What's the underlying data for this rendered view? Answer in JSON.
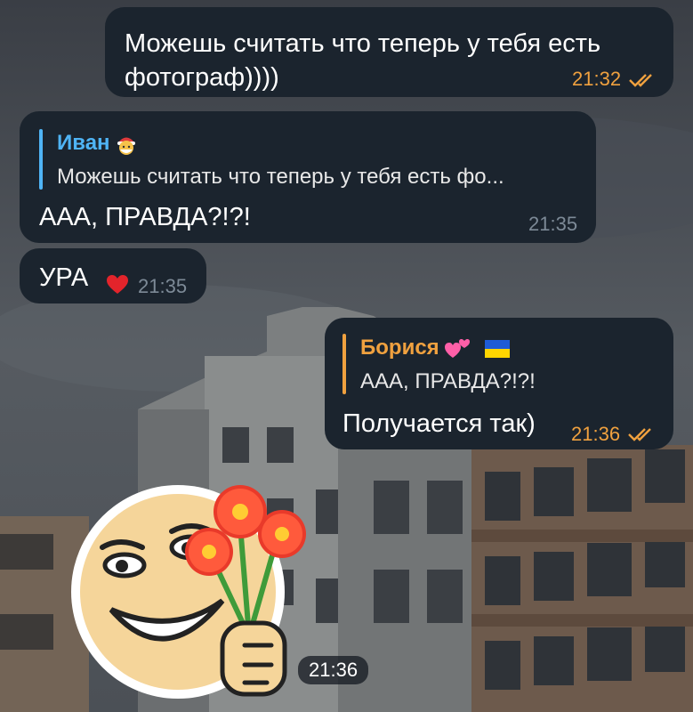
{
  "messages": [
    {
      "text": "Можешь считать что теперь у тебя есть фотограф))))",
      "time": "21:32"
    },
    {
      "reply_name": "Иван",
      "reply_text": "Можешь считать что теперь у тебя есть фо...",
      "text": "ААА, ПРАВДА?!?!",
      "time": "21:35"
    },
    {
      "text": "УРА",
      "reaction": "heart-reaction",
      "time": "21:35"
    },
    {
      "reply_name": "Борися",
      "reply_text": "ААА, ПРАВДА?!?!",
      "text": "Получается так)",
      "time": "21:36"
    }
  ],
  "sticker": {
    "name": "smiley-with-flowers-sticker",
    "time": "21:36"
  },
  "colors": {
    "bubble": "#1b242e",
    "outgoing_time": "#f0a13f",
    "incoming_time": "#7d8a97",
    "reply_incoming": "#4fb4f5",
    "reply_outgoing": "#f0a13f",
    "reaction": "#e3242b"
  }
}
